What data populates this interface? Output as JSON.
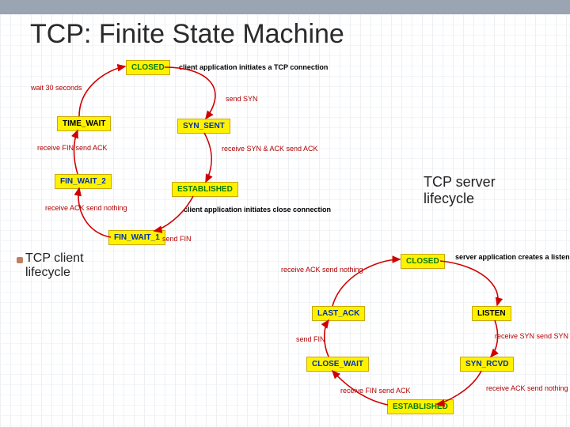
{
  "title": "TCP: Finite State Machine",
  "captions": {
    "server": "TCP server\nlifecycle",
    "client": "TCP client\nlifecycle"
  },
  "client": {
    "states": {
      "closed": "CLOSED",
      "syn_sent": "SYN_SENT",
      "established": "ESTABLISHED",
      "fin_wait_1": "FIN_WAIT_1",
      "fin_wait_2": "FIN_WAIT_2",
      "time_wait": "TIME_WAIT"
    },
    "ann": {
      "init": "client application\ninitiates a TCP connection",
      "send_syn": "send SYN",
      "recv_synack": "receive SYN & ACK\nsend ACK",
      "close": "client application\ninitiates close connection",
      "send_fin": "send FIN",
      "recv_ack": "receive ACK\nsend nothing",
      "recv_fin": "receive FIN\nsend ACK",
      "wait30": "wait 30 seconds"
    }
  },
  "server": {
    "states": {
      "closed": "CLOSED",
      "listen": "LISTEN",
      "syn_rcvd": "SYN_RCVD",
      "established": "ESTABLISHED",
      "close_wait": "CLOSE_WAIT",
      "last_ack": "LAST_ACK"
    },
    "ann": {
      "create": "server application\ncreates a listen socket",
      "recv_syn": "receive SYN\nsend SYN & ACK",
      "recv_ack": "receive ACK\nsend nothing",
      "recv_fin": "receive FIN\nsend ACK",
      "send_fin": "send FIN",
      "recv_ack2": "receive ACK\nsend nothing"
    }
  }
}
